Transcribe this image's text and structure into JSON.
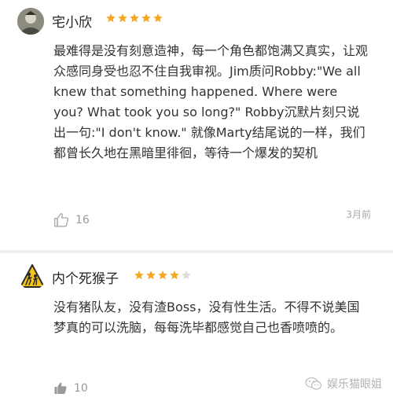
{
  "reviews": [
    {
      "username": "宅小欣",
      "rating": 5,
      "body": "最难得是没有刻意造神，每一个角色都饱满又真实，让观众感同身受也忍不住自我审视。Jim质问Robby:\"We all knew that something happened. Where were you? What took you so long?\" Robby沉默片刻只说出一句:\"I don't know.\" 就像Marty结尾说的一样，我们都曾长久地在黑暗里徘徊，等待一个爆发的契机",
      "likes": "16",
      "time": "3月前"
    },
    {
      "username": "内个死猴子",
      "rating": 4,
      "body": "没有猪队友，没有渣Boss，没有性生活。不得不说美国梦真的可以洗脑，每每洗毕都感觉自己也香喷喷的。",
      "likes": "10"
    }
  ],
  "watermark": "娱乐猫眼姐",
  "colors": {
    "star_filled": "#f5a623",
    "star_empty": "#dddddd"
  }
}
